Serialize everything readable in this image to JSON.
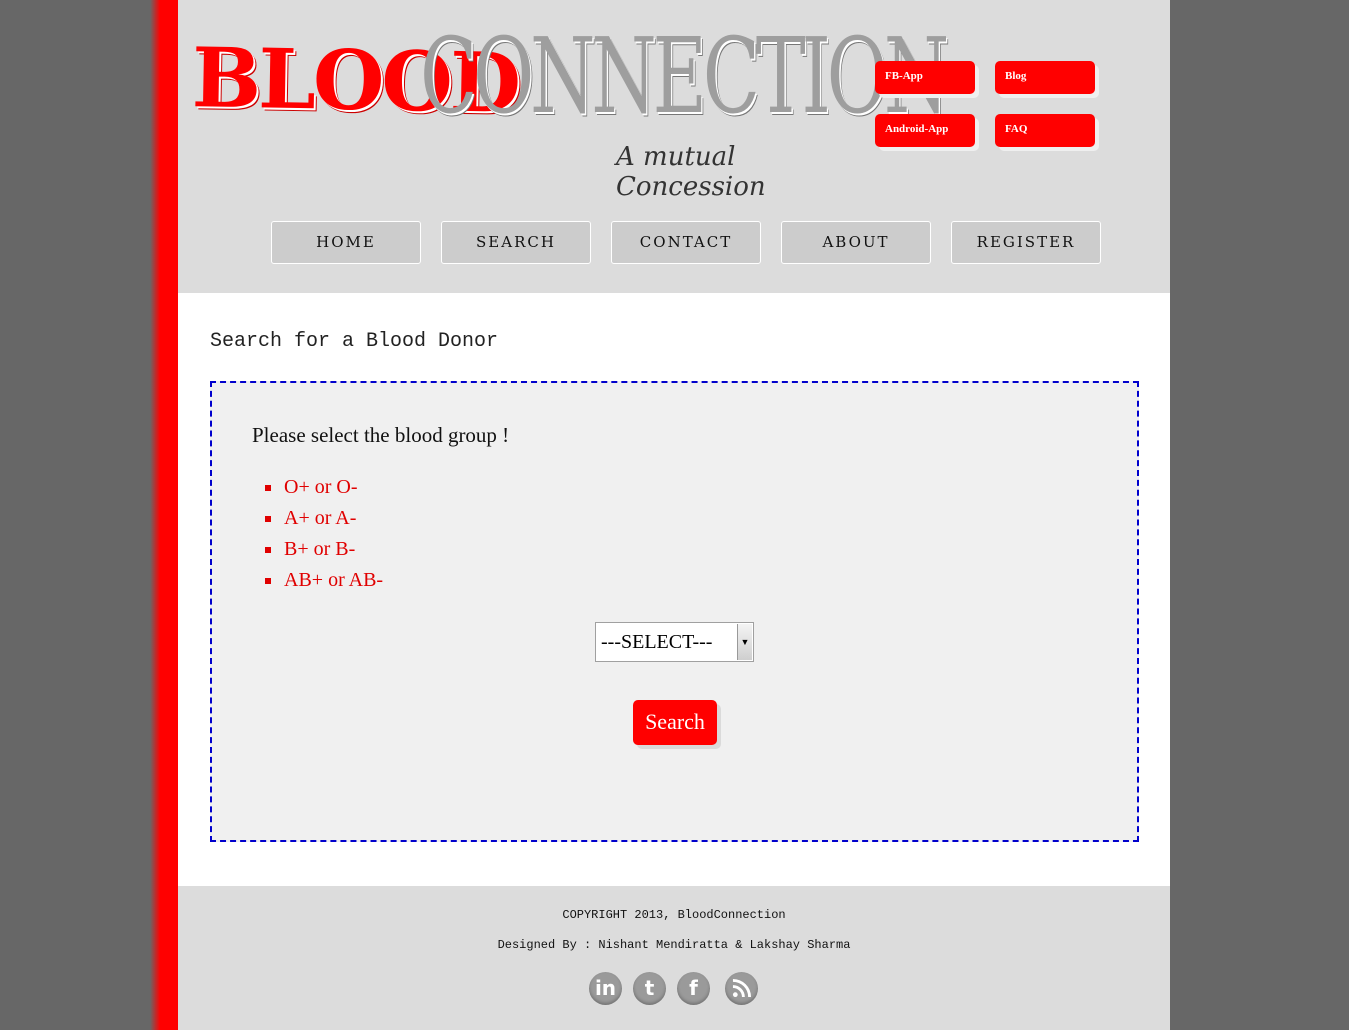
{
  "brand": {
    "name_part1": "BLOOD",
    "name_part2": "CONNECTION",
    "tagline": "A mutual Concession",
    "primary_color": "#ff0000",
    "secondary_color": "#9e9e9e"
  },
  "top_links": [
    {
      "label": "FB-App"
    },
    {
      "label": "Blog"
    },
    {
      "label": "Android-App"
    },
    {
      "label": "FAQ"
    }
  ],
  "nav": [
    {
      "label": "HOME"
    },
    {
      "label": "SEARCH"
    },
    {
      "label": "CONTACT"
    },
    {
      "label": "ABOUT"
    },
    {
      "label": "REGISTER"
    }
  ],
  "main": {
    "title": "Search for a Blood Donor",
    "prompt": "Please select the blood group !",
    "groups": [
      "O+ or O-",
      "A+ or A-",
      "B+ or B-",
      "AB+ or AB-"
    ],
    "select_value": "---SELECT---",
    "search_button": "Search"
  },
  "footer": {
    "copyright": "COPYRIGHT 2013, BloodConnection",
    "designed_by": "Designed By : Nishant Mendiratta & Lakshay Sharma",
    "social_icons": [
      "linkedin-icon",
      "tumblr-icon",
      "facebook-icon",
      "rss-icon"
    ],
    "linkedin_glyph": "in",
    "tumblr_glyph": "t",
    "facebook_glyph": "f"
  }
}
